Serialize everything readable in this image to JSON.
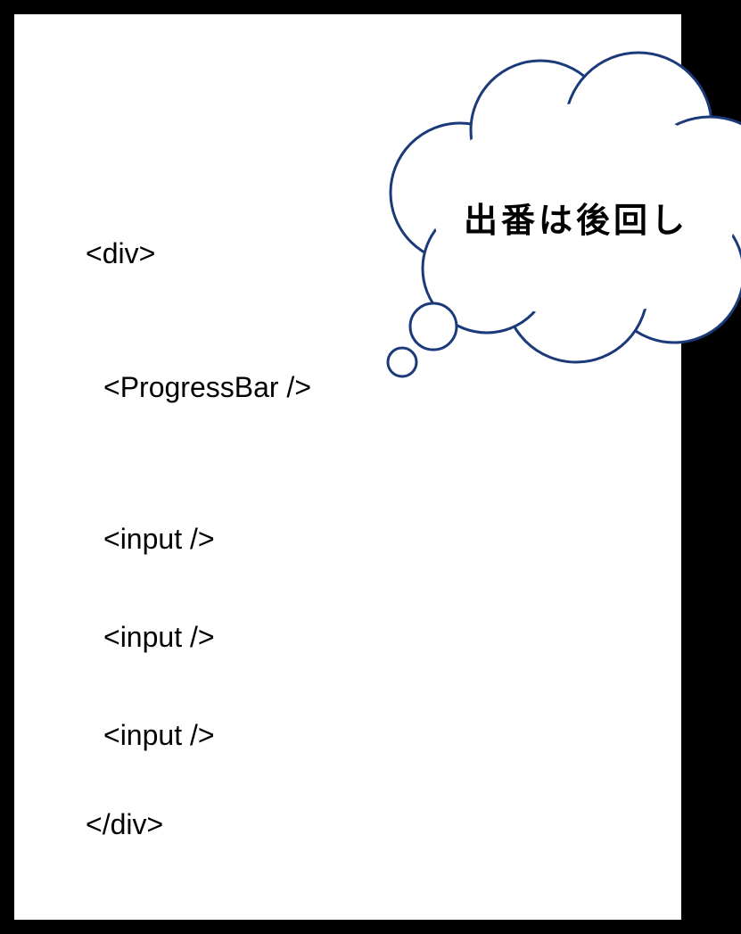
{
  "code": {
    "line1": "<div>",
    "line2": "<ProgressBar />",
    "line3": "<input />",
    "line4": "<input />",
    "line5": "<input />",
    "line6": "</div>"
  },
  "bubble": {
    "text": "出番は後回し"
  }
}
